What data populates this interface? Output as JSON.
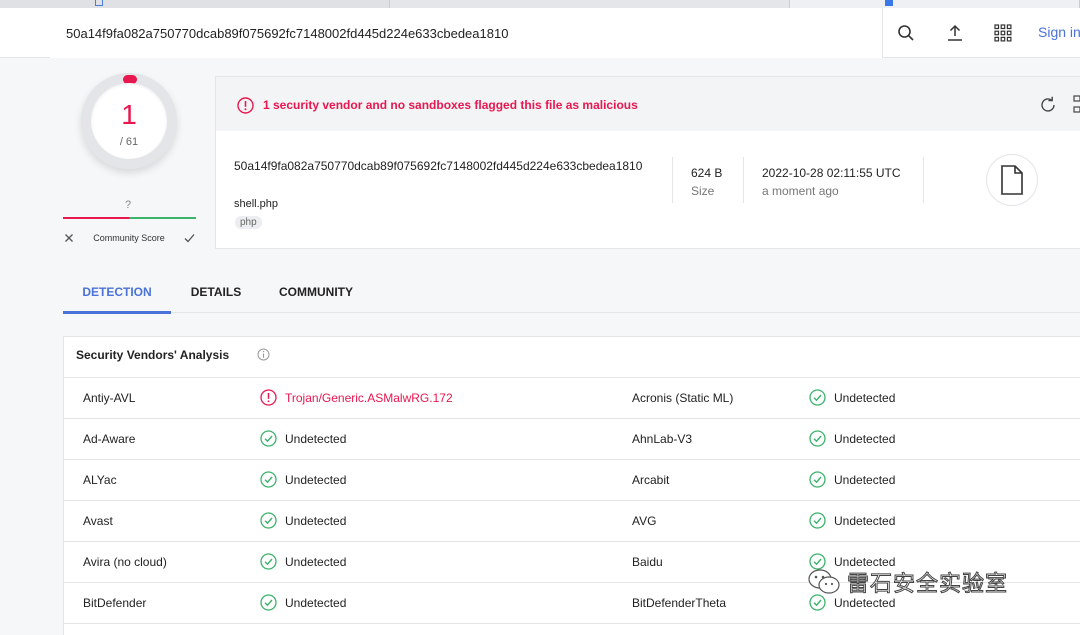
{
  "header": {
    "search_value": "50a14f9fa082a750770dcab89f075692fc7148002fd445d224e633cbedea1810",
    "sign_in": "Sign in"
  },
  "score": {
    "detections": "1",
    "total": "/ 61",
    "community_unknown": "?",
    "community_label": "Community Score"
  },
  "summary": {
    "alert": "1 security vendor and no sandboxes flagged this file as malicious",
    "hash": "50a14f9fa082a750770dcab89f075692fc7148002fd445d224e633cbedea1810",
    "filename": "shell.php",
    "tag": "php",
    "size_value": "624 B",
    "size_label": "Size",
    "date_value": "2022-10-28 02:11:55 UTC",
    "date_label": "a moment ago"
  },
  "tabs": [
    {
      "label": "DETECTION",
      "active": true
    },
    {
      "label": "DETAILS",
      "active": false
    },
    {
      "label": "COMMUNITY",
      "active": false
    }
  ],
  "vendors": {
    "title": "Security Vendors' Analysis",
    "rows": [
      {
        "left_name": "Antiy-AVL",
        "left_result": "Trojan/Generic.ASMalwRG.172",
        "left_status": "malicious",
        "right_name": "Acronis (Static ML)",
        "right_result": "Undetected",
        "right_status": "undetected"
      },
      {
        "left_name": "Ad-Aware",
        "left_result": "Undetected",
        "left_status": "undetected",
        "right_name": "AhnLab-V3",
        "right_result": "Undetected",
        "right_status": "undetected"
      },
      {
        "left_name": "ALYac",
        "left_result": "Undetected",
        "left_status": "undetected",
        "right_name": "Arcabit",
        "right_result": "Undetected",
        "right_status": "undetected"
      },
      {
        "left_name": "Avast",
        "left_result": "Undetected",
        "left_status": "undetected",
        "right_name": "AVG",
        "right_result": "Undetected",
        "right_status": "undetected"
      },
      {
        "left_name": "Avira (no cloud)",
        "left_result": "Undetected",
        "left_status": "undetected",
        "right_name": "Baidu",
        "right_result": "Undetected",
        "right_status": "undetected"
      },
      {
        "left_name": "BitDefender",
        "left_result": "Undetected",
        "left_status": "undetected",
        "right_name": "BitDefenderTheta",
        "right_result": "Undetected",
        "right_status": "undetected"
      }
    ]
  },
  "watermark": {
    "text": "雷石安全实验室"
  },
  "colors": {
    "malicious": "#e8174f",
    "clean": "#3bb36b",
    "accent": "#4a72d8"
  },
  "icons": {
    "search": "search-icon",
    "upload": "upload-icon",
    "apps": "grid-icon",
    "alert": "alert-circle-icon",
    "reload": "reload-icon",
    "file": "file-icon",
    "check": "check-circle-icon",
    "info": "info-icon"
  }
}
